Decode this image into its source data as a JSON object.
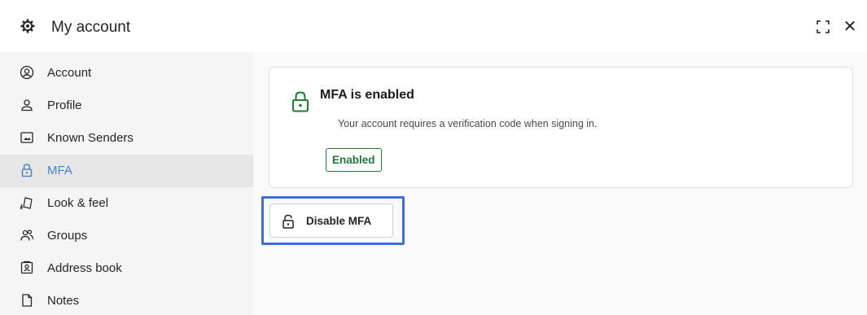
{
  "header": {
    "title": "My account",
    "title_icon": "gear-icon",
    "expand_icon": "expand-icon",
    "close_label": "✕"
  },
  "sidebar": {
    "items": [
      {
        "label": "Account",
        "icon": "user-circle-icon",
        "active": false
      },
      {
        "label": "Profile",
        "icon": "person-icon",
        "active": false
      },
      {
        "label": "Known Senders",
        "icon": "image-frame-icon",
        "active": false
      },
      {
        "label": "MFA",
        "icon": "lock-icon",
        "active": true
      },
      {
        "label": "Look & feel",
        "icon": "paint-brush-icon",
        "active": false
      },
      {
        "label": "Groups",
        "icon": "people-icon",
        "active": false
      },
      {
        "label": "Address book",
        "icon": "contact-card-icon",
        "active": false
      },
      {
        "label": "Notes",
        "icon": "document-icon",
        "active": false
      }
    ]
  },
  "main": {
    "card": {
      "title": "MFA is enabled",
      "description": "Your account requires a verification code when signing in.",
      "status": "Enabled",
      "icon": "lock-icon"
    },
    "disable_button": {
      "label": "Disable MFA",
      "icon": "unlock-icon"
    }
  },
  "colors": {
    "accent": "#4a86c6",
    "success": "#1f7a36",
    "highlight": "#3a6fd8",
    "sidebar_bg": "#f5f5f5",
    "active_bg": "#e6e6e6"
  }
}
